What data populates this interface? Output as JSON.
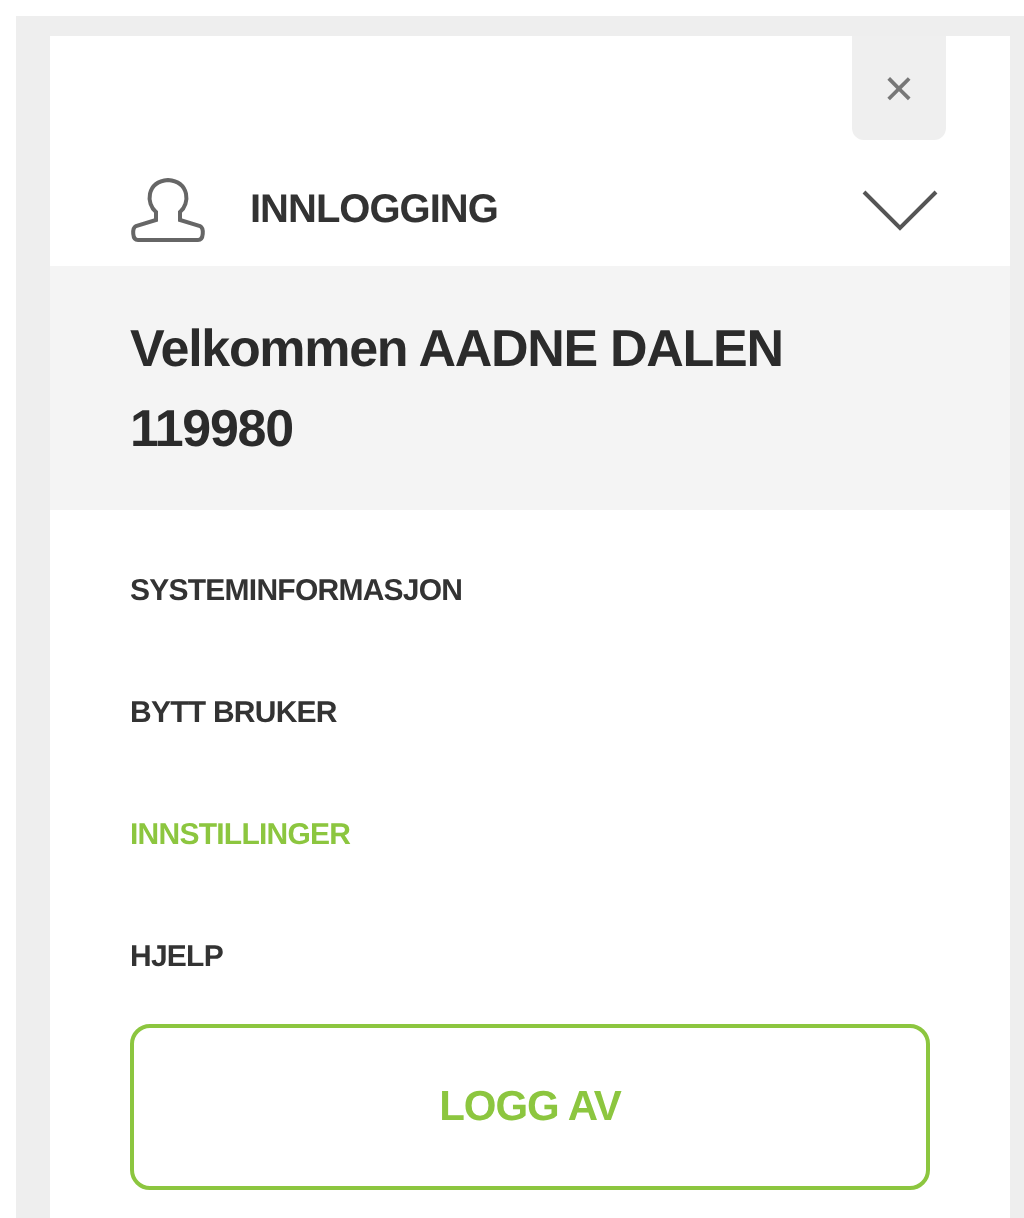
{
  "close_button": {
    "label": "×"
  },
  "header": {
    "title": "INNLOGGING",
    "expanded": true
  },
  "welcome": {
    "text": "Velkommen AADNE DALEN 119980"
  },
  "menu": [
    {
      "label": "SYSTEMINFORMASJON",
      "selected": false
    },
    {
      "label": "BYTT BRUKER",
      "selected": false
    },
    {
      "label": "INNSTILLINGER",
      "selected": true
    },
    {
      "label": "HJELP",
      "selected": false
    }
  ],
  "logout_button": {
    "label": "LOGG AV"
  }
}
